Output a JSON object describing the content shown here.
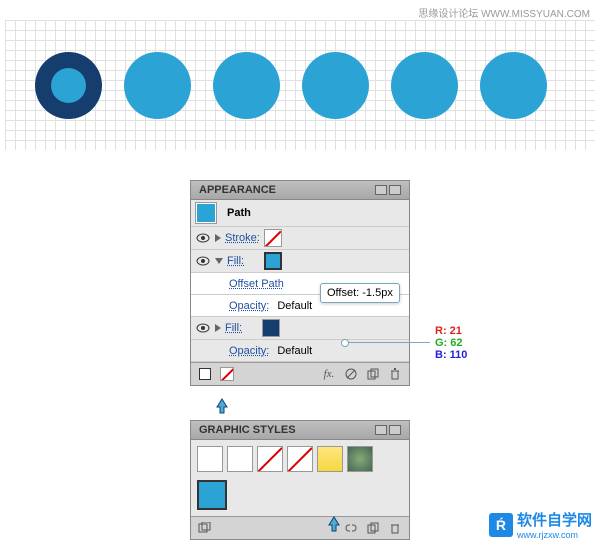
{
  "watermark_top": "思缘设计论坛  WWW.MISSYUAN.COM",
  "appearance": {
    "title": "APPEARANCE",
    "path_label": "Path",
    "stroke_label": "Stroke:",
    "fill_label": "Fill:",
    "offset_path_label": "Offset Path",
    "opacity_label": "Opacity:",
    "opacity_value": "Default",
    "fx_label": "fx.",
    "tooltip_offset": "Offset: -1.5px",
    "colors": {
      "light_blue": "#2ba3d4",
      "dark_blue": "#153e6e"
    }
  },
  "rgb": {
    "r_label": "R:",
    "r_value": "21",
    "g_label": "G:",
    "g_value": "62",
    "b_label": "B:",
    "b_value": "110"
  },
  "styles": {
    "title": "GRAPHIC STYLES"
  },
  "watermark_bottom": {
    "text": "软件自学网",
    "url": "www.rjzxw.com"
  }
}
